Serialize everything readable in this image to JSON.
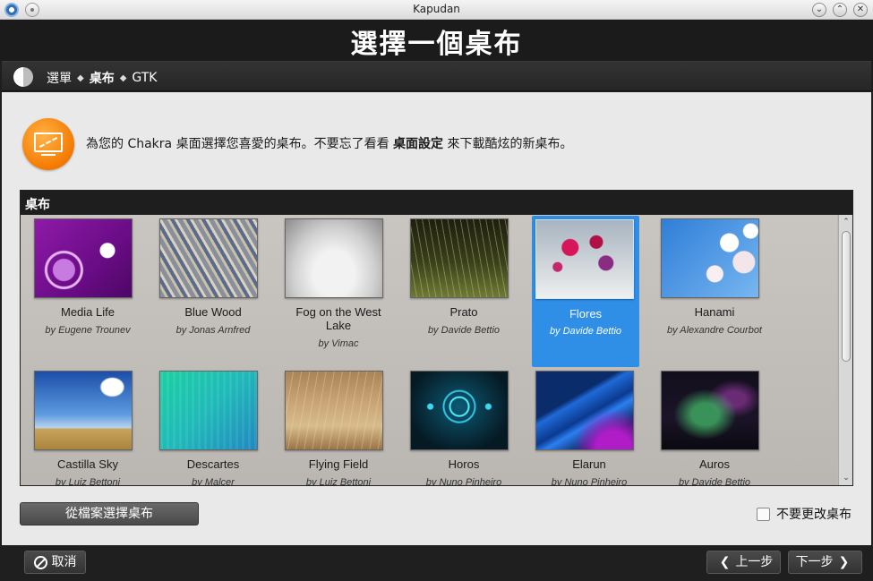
{
  "window": {
    "title": "Kapudan",
    "min_glyph": "⌄",
    "max_glyph": "⌃",
    "close_glyph": "✕"
  },
  "header": {
    "title": "選擇一個桌布"
  },
  "breadcrumb": {
    "items": [
      "選單",
      "桌布",
      "GTK"
    ],
    "separator": "◆"
  },
  "intro": {
    "text_before": "為您的 Chakra 桌面選擇您喜愛的桌布。不要忘了看看 ",
    "text_bold": "桌面設定",
    "text_after": " 來下載酷炫的新桌布。"
  },
  "wallpapers": {
    "heading": "桌布",
    "items": [
      {
        "name": "Media Life",
        "author": "by Eugene Trounev",
        "selected": false
      },
      {
        "name": "Blue Wood",
        "author": "by Jonas Arnfred",
        "selected": false
      },
      {
        "name": "Fog on the West Lake",
        "author": "by Vimac",
        "selected": false
      },
      {
        "name": "Prato",
        "author": "by Davide Bettio",
        "selected": false
      },
      {
        "name": "Flores",
        "author": "by Davide Bettio",
        "selected": true
      },
      {
        "name": "Hanami",
        "author": "by Alexandre Courbot",
        "selected": false
      },
      {
        "name": "Castilla Sky",
        "author": "by Luiz Bettoni",
        "selected": false
      },
      {
        "name": "Descartes",
        "author": "by Malcer",
        "selected": false
      },
      {
        "name": "Flying Field",
        "author": "by Luiz Bettoni",
        "selected": false
      },
      {
        "name": "Horos",
        "author": "by Nuno Pinheiro",
        "selected": false
      },
      {
        "name": "Elarun",
        "author": "by Nuno Pinheiro",
        "selected": false
      },
      {
        "name": "Auros",
        "author": "by Davide Bettio",
        "selected": false
      }
    ]
  },
  "scrollbar": {
    "up_glyph": "⌃",
    "down_glyph": "⌄"
  },
  "actions": {
    "choose_from_file": "從檔案選擇桌布",
    "keep_current": "不要更改桌布",
    "keep_checked": false
  },
  "footer": {
    "cancel": "取消",
    "back": "上一步",
    "next": "下一步",
    "back_glyph": "❮",
    "next_glyph": "❯"
  },
  "colors": {
    "accent": "#2f8fe6",
    "intro_icon": "#f47a00",
    "header_bg": "#1b1b1b"
  }
}
